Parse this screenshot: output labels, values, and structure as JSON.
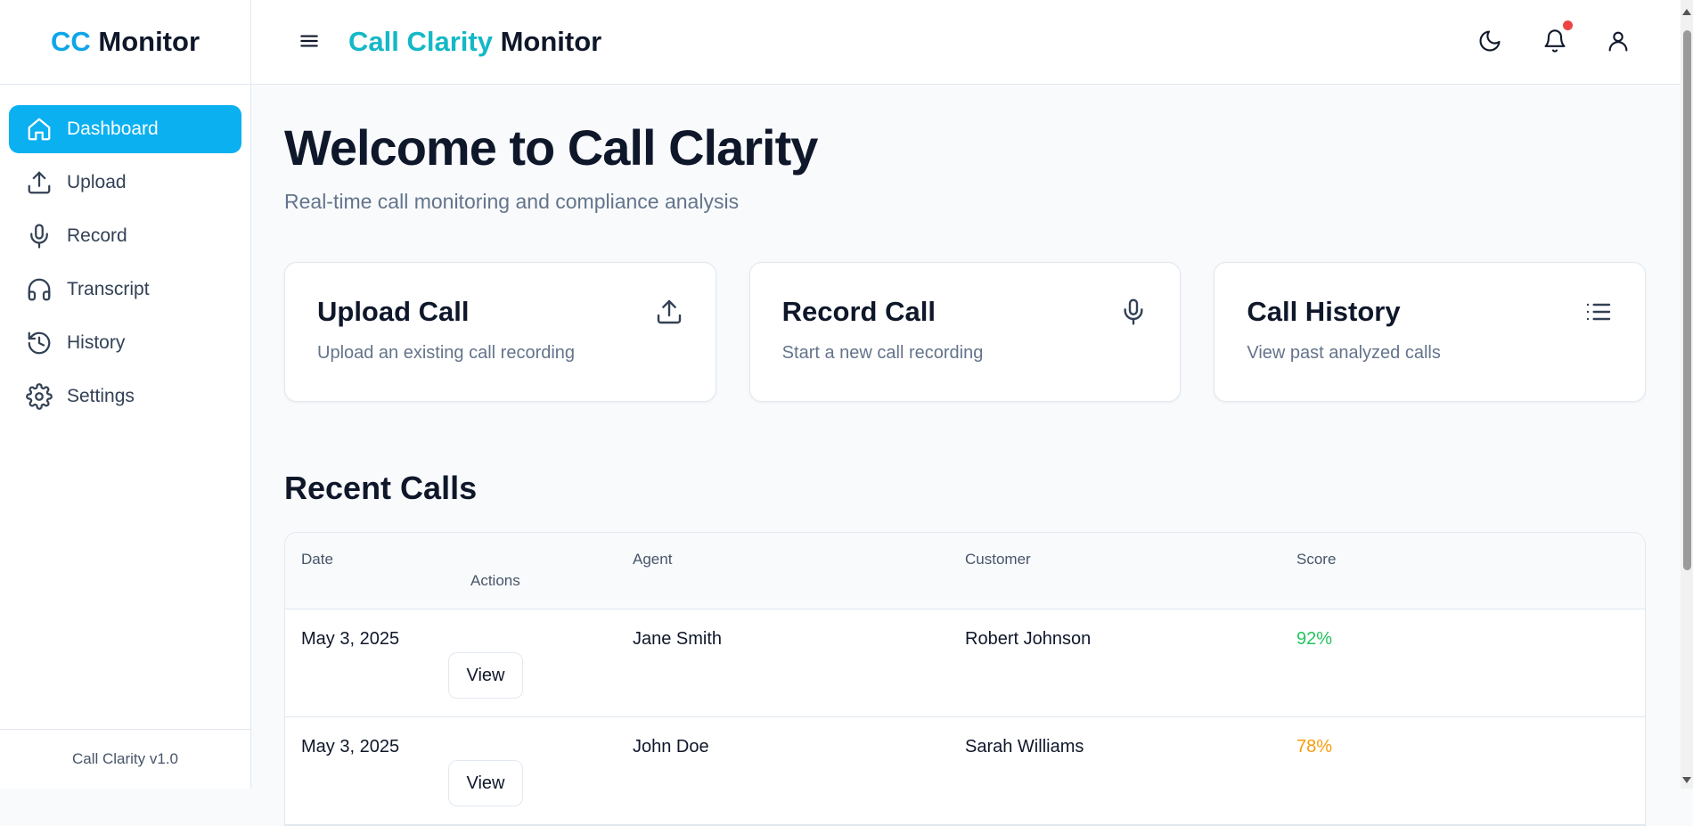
{
  "sidebar": {
    "logo": {
      "part1": "CC",
      "part2": "Monitor"
    },
    "items": [
      {
        "label": "Dashboard",
        "icon": "home-icon",
        "active": true
      },
      {
        "label": "Upload",
        "icon": "upload-icon"
      },
      {
        "label": "Record",
        "icon": "mic-icon"
      },
      {
        "label": "Transcript",
        "icon": "headphones-icon"
      },
      {
        "label": "History",
        "icon": "history-icon"
      },
      {
        "label": "Settings",
        "icon": "gear-icon"
      }
    ],
    "version": "Call Clarity v1.0"
  },
  "header": {
    "title_part1": "Call Clarity",
    "title_part2": "Monitor",
    "icons": [
      "menu-icon",
      "moon-icon",
      "bell-icon",
      "user-icon"
    ]
  },
  "main": {
    "title": "Welcome to Call Clarity",
    "subtitle": "Real-time call monitoring and compliance analysis",
    "cards": [
      {
        "title": "Upload Call",
        "desc": "Upload an existing call recording",
        "icon": "upload-icon"
      },
      {
        "title": "Record Call",
        "desc": "Start a new call recording",
        "icon": "mic-icon"
      },
      {
        "title": "Call History",
        "desc": "View past analyzed calls",
        "icon": "list-icon"
      }
    ],
    "recent_title": "Recent Calls",
    "table": {
      "headers": [
        "Date",
        "Actions",
        "Agent",
        "Customer",
        "Score"
      ],
      "rows": [
        {
          "date": "May 3, 2025",
          "agent": "Jane Smith",
          "customer": "Robert Johnson",
          "score": "92%",
          "action": "View"
        },
        {
          "date": "May 3, 2025",
          "agent": "John Doe",
          "customer": "Sarah Williams",
          "score": "78%",
          "action": "View"
        }
      ]
    }
  },
  "colors": {
    "accent": "#0ab0f0",
    "brand_blue": "#0ea5e9",
    "brand_teal": "#14b8c6",
    "score_good": "#22c55e",
    "score_medium": "#f59e0b",
    "notification": "#ef4444"
  }
}
